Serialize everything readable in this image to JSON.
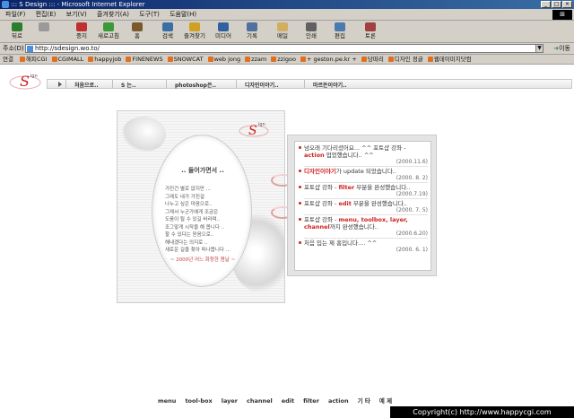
{
  "window": {
    "title": "::: S Design ::: - Microsoft Internet Explorer"
  },
  "menubar": [
    "파일(F)",
    "편집(E)",
    "보기(V)",
    "즐겨찾기(A)",
    "도구(T)",
    "도움말(H)"
  ],
  "toolbar": [
    {
      "label": "뒤로",
      "icon": "back-arrow-icon",
      "color": "#2d7d2d"
    },
    {
      "label": "",
      "icon": "forward-arrow-icon",
      "color": "#9a9a9a"
    },
    {
      "label": "중지",
      "icon": "stop-icon",
      "color": "#c03030"
    },
    {
      "label": "새로고침",
      "icon": "refresh-icon",
      "color": "#3a9a3a"
    },
    {
      "label": "홈",
      "icon": "home-icon",
      "color": "#7a5a2a"
    },
    {
      "label": "검색",
      "icon": "search-icon",
      "color": "#3a6ea5"
    },
    {
      "label": "즐겨찾기",
      "icon": "favorites-icon",
      "color": "#d0a020"
    },
    {
      "label": "미디어",
      "icon": "media-icon",
      "color": "#3060a0"
    },
    {
      "label": "기록",
      "icon": "history-icon",
      "color": "#5070a0"
    },
    {
      "label": "메일",
      "icon": "mail-icon",
      "color": "#d0b060"
    },
    {
      "label": "인쇄",
      "icon": "print-icon",
      "color": "#606060"
    },
    {
      "label": "편집",
      "icon": "edit-icon",
      "color": "#4a7ab0"
    },
    {
      "label": "토론",
      "icon": "discuss-icon",
      "color": "#a04040"
    }
  ],
  "address": {
    "label": "주소(D)",
    "url": "http://sdesign.wo.to/",
    "go": "이동"
  },
  "links": {
    "label": "연결",
    "items": [
      "해피CGI",
      "CGIMALL",
      "happyjob",
      "FINENEWS",
      "SNOWCAT",
      "web jong",
      "zzam",
      "zzigoo",
      "+ geston.pe.kr +",
      "당떠리",
      "디자인 정글",
      "웹데이미지닷컴"
    ]
  },
  "site": {
    "logo_text": "S",
    "logo_small": "ign",
    "nav": [
      "처음으로..",
      "S 는..",
      "photoshop은..",
      "디자인이야기..",
      "마르돈이야기.."
    ],
    "intro": {
      "title": ".. 들어가면서 ..",
      "lines": [
        "가진건 별로 없지만 ...",
        "그래도 내가 가진걸",
        "나누고 싶은 마음으로..",
        "그래서 누군가에게 조금은",
        "도움이 될 수 있길 바라며..",
        "조그맣게 시작을 해 봅니다 ..",
        "할 수 있다는 믿음으로..",
        "해내겠다는 의지로 ..",
        "새로운 길을 찾아 떠나봅니다 ..."
      ],
      "footer": "~ 2000년 어느 화창한 봄날 ~"
    },
    "news": [
      {
        "text": "넘오래 기다리셨어요... ^^ 포토샵 강좌 - ",
        "highlight": "action",
        "rest": " 업었했습니다.. ^^",
        "date": "(2000.11.6)"
      },
      {
        "text": "",
        "highlight": "디자인이야기",
        "rest": "가 update 되었습니다..",
        "date": "(2000. 8. 2)"
      },
      {
        "text": "포토샵 강좌 - ",
        "highlight": "filter",
        "rest": " 부분을 완성했습니다..",
        "date": "(2000.7.19)"
      },
      {
        "text": "포토샵 강좌 - ",
        "highlight": "edit",
        "rest": " 부분을 완성했습니다..",
        "date": "(2000. 7. 5)"
      },
      {
        "text": "포토샵 강좌 - ",
        "highlight": "menu, toolbox, layer, channel",
        "rest": "까지 완성했습니다..",
        "date": "(2000.6.20)"
      },
      {
        "text": "처음 입는 제 홈입니다.... ^^",
        "highlight": "",
        "rest": "",
        "date": "(2000. 6. 1)"
      }
    ],
    "footer_menu": [
      "menu",
      "tool-box",
      "layer",
      "channel",
      "edit",
      "filter",
      "action",
      "기 타",
      "예 제"
    ],
    "copyright": "Copyright(c) http://www.happycgi.com"
  }
}
